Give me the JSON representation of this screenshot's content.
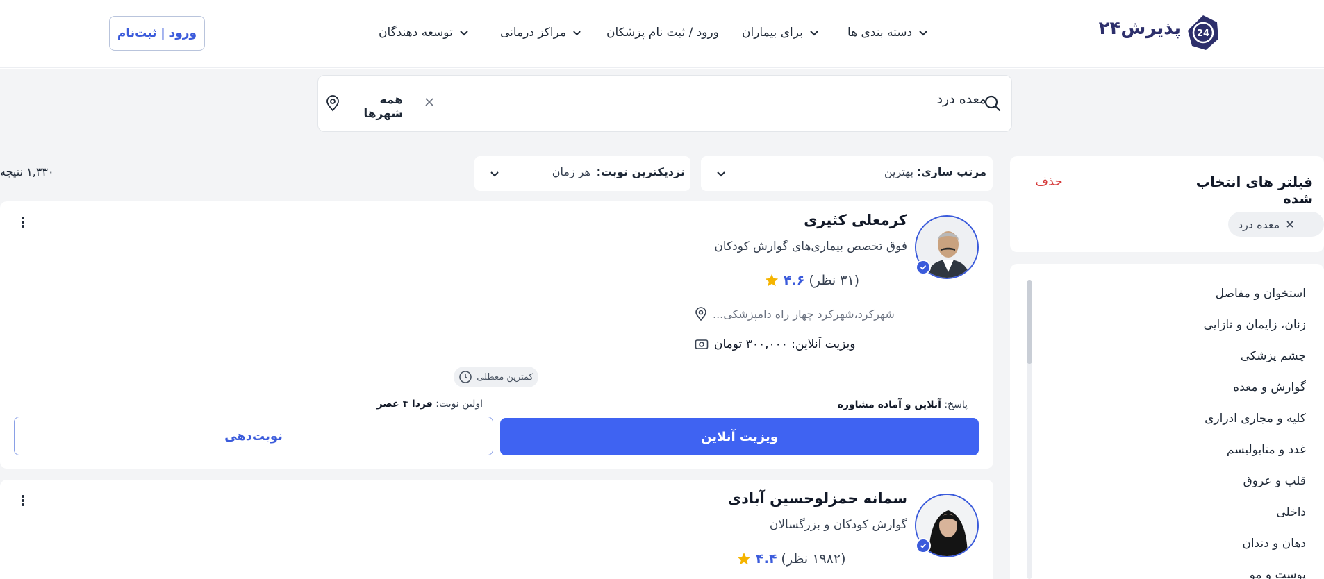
{
  "header": {
    "logo_text": "پذیرش۲۴",
    "logo_badge_text": "24",
    "nav": [
      {
        "label": "دسته بندی ها",
        "has_dropdown": true
      },
      {
        "label": "برای بیماران",
        "has_dropdown": true
      },
      {
        "label": "ورود / ثبت نام پزشکان",
        "has_dropdown": false
      },
      {
        "label": "مراکز درمانی",
        "has_dropdown": true
      },
      {
        "label": "توسعه دهندگان",
        "has_dropdown": true
      }
    ],
    "login_label": "ورود | ثبت‌نام"
  },
  "search": {
    "query": "معده درد",
    "city": "همه شهرها"
  },
  "filters": {
    "sort_label": "مرتب سازی:",
    "sort_value": "بهترین",
    "time_label": "نزدیکترین نوبت:",
    "time_value": "هر زمان",
    "results": "۱,۳۳۰ نتیجه"
  },
  "sidebar": {
    "title": "فیلتر های انتخاب شده",
    "clear_label": "حذف",
    "chips": [
      {
        "label": "معده درد"
      }
    ],
    "categories": [
      {
        "label": "استخوان و مفاصل"
      },
      {
        "label": "زنان، زایمان و نازایی"
      },
      {
        "label": "چشم پزشکی"
      },
      {
        "label": "گوارش و معده"
      },
      {
        "label": "کلیه و مجاری ادراری"
      },
      {
        "label": "غدد و متابولیسم"
      },
      {
        "label": "قلب و عروق"
      },
      {
        "label": "داخلی"
      },
      {
        "label": "دهان و دندان"
      },
      {
        "label": "پوست و مو"
      }
    ]
  },
  "doctors": [
    {
      "name": "کرمعلی کثیری",
      "specialty": "فوق تخصص بیماری‌های گوارش کودکان",
      "rating": "۴.۶",
      "reviews": "(۳۱ نظر)",
      "address": "شهرکرد،شهرکرد چهار راه دامپزشکی...",
      "fee": "ویزیت آنلاین: ۳۰۰,۰۰۰ تومان",
      "badge": "کمترین معطلی",
      "response_label": "پاسخ:",
      "response_value": "آنلاین و آماده مشاوره",
      "first_slot_label": "اولین نوبت:",
      "first_slot_value": "فردا ۴ عصر",
      "primary_button": "ویزیت آنلاین",
      "secondary_button": "نوبت‌دهی"
    },
    {
      "name": "سمانه حمزلوحسین آبادی",
      "specialty": "گوارش کودکان و بزرگسالان",
      "rating": "۴.۴",
      "reviews": "(۱۹۸۲ نظر)"
    }
  ],
  "colors": {
    "accent": "#3f63f2",
    "danger": "#d63939",
    "star": "#f5b400",
    "background": "#f3f4f6"
  }
}
